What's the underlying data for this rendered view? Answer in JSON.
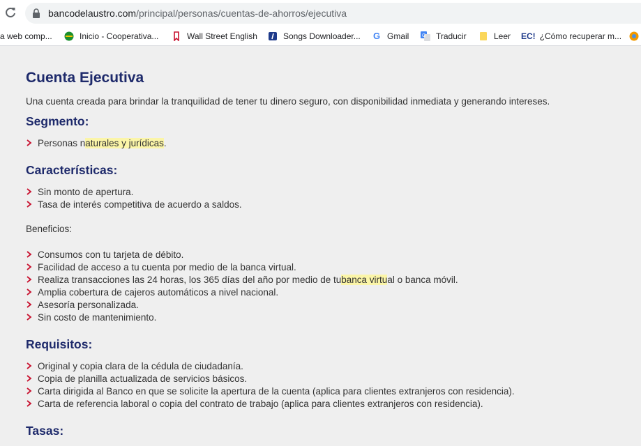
{
  "browser": {
    "url_domain": "bancodelaustro.com",
    "url_path": "/principal/personas/cuentas-de-ahorros/ejecutiva",
    "bookmarks": [
      {
        "label": "a web comp...",
        "icon": "web-icon"
      },
      {
        "label": "Inicio - Cooperativa...",
        "icon": "cooperativa-icon"
      },
      {
        "label": "Wall Street English",
        "icon": "wse-icon"
      },
      {
        "label": "Songs Downloader...",
        "icon": "songs-icon"
      },
      {
        "label": "Gmail",
        "icon": "google-icon"
      },
      {
        "label": "Traducir",
        "icon": "translate-icon"
      },
      {
        "label": "Leer",
        "icon": "note-icon"
      },
      {
        "label": "¿Cómo recuperar m...",
        "icon": "ec-icon",
        "prefix": "EC!"
      }
    ]
  },
  "page": {
    "title": "Cuenta Ejecutiva",
    "intro": "Una cuenta creada para brindar la tranquilidad de tener tu dinero seguro, con disponibilidad inmediata y generando intereses.",
    "segmento": {
      "heading": "Segmento:",
      "item_pre": "Personas n",
      "item_hl": "aturales y jurídicas",
      "item_post": "."
    },
    "caracteristicas": {
      "heading": "Características:",
      "items": [
        "Sin monto de apertura.",
        "Tasa de interés competitiva de acuerdo a saldos."
      ]
    },
    "beneficios": {
      "label": "Beneficios:",
      "item1": "Consumos con tu tarjeta de débito.",
      "item2": "Facilidad de acceso a tu cuenta por medio de la banca virtual.",
      "item3_pre": "Realiza transacciones las 24 horas, los 365 días del año por medio de tu ",
      "item3_hl": "banca virtu",
      "item3_post": "al o banca móvil.",
      "item4": "Amplia cobertura de cajeros automáticos a nivel nacional.",
      "item5": "Asesoría personalizada.",
      "item6": "Sin costo de mantenimiento."
    },
    "requisitos": {
      "heading": "Requisitos:",
      "items": [
        "Original y copia clara de la cédula de ciudadanía.",
        "Copia de planilla actualizada de servicios básicos.",
        "Carta dirigida al Banco en que se solicite la apertura de la cuenta (aplica para clientes extranjeros con residencia).",
        "Carta de referencia laboral o copia del contrato de trabajo (aplica para clientes extranjeros con residencia)."
      ]
    },
    "tasas": {
      "heading": "Tasas:"
    }
  },
  "colors": {
    "heading": "#1e2a6b",
    "bullet": "#c8102e",
    "highlight": "#fbf5a8"
  }
}
